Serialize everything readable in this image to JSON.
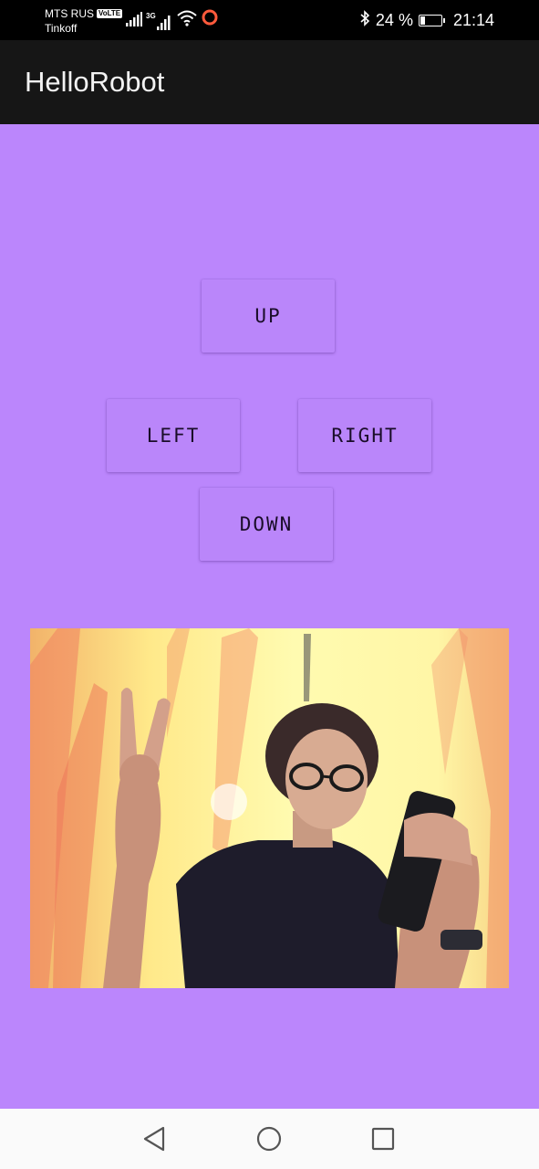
{
  "status_bar": {
    "carrier": "MTS RUS",
    "volte": "VoLTE",
    "secondary_carrier": "Tinkoff",
    "network_type": "3G",
    "battery_percent": "24 %",
    "battery_level": 0.24,
    "time": "21:14",
    "icons": [
      "signal-icon",
      "signal-3g-icon",
      "wifi-icon",
      "record-icon",
      "bluetooth-icon",
      "battery-icon"
    ]
  },
  "app_bar": {
    "title": "HelloRobot"
  },
  "controls": {
    "up": "UP",
    "left": "LEFT",
    "right": "RIGHT",
    "down": "DOWN"
  },
  "colors": {
    "background": "#bb86fc",
    "app_bar": "#161616",
    "status_bar": "#000000",
    "nav_bar": "#fafafa",
    "record_indicator": "#ff5a3c"
  },
  "nav_bar": {
    "icons": [
      "back-icon",
      "home-icon",
      "recents-icon"
    ]
  }
}
